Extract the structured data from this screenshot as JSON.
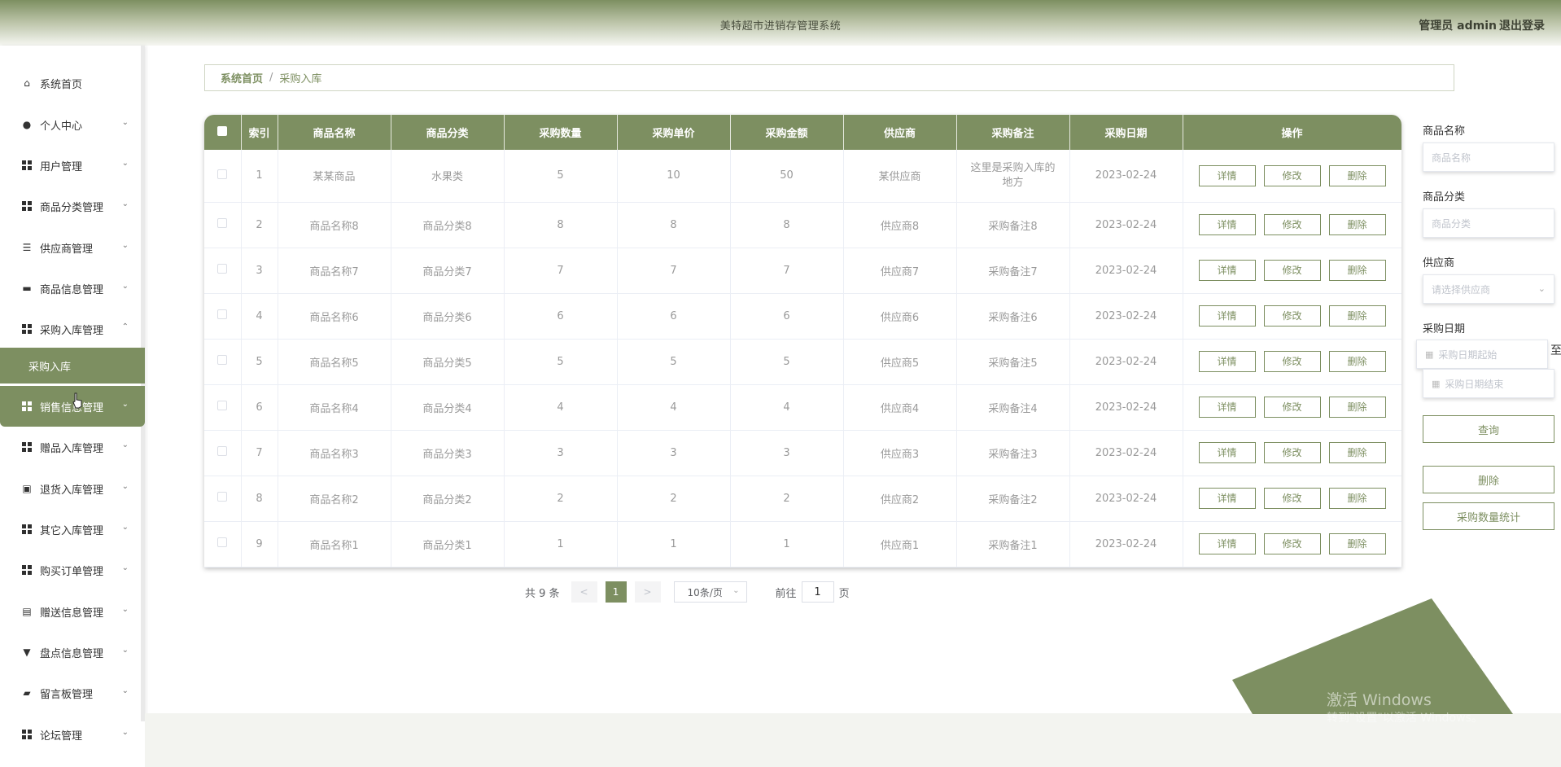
{
  "header": {
    "title": "美特超市进销存管理系统",
    "user_label": "管理员 admin",
    "logout_label": "退出登录"
  },
  "sidebar": {
    "items": [
      {
        "label": "系统首页",
        "icon": "home-icon",
        "chevron": ""
      },
      {
        "label": "个人中心",
        "icon": "user-icon",
        "chevron": "⌄"
      },
      {
        "label": "用户管理",
        "icon": "grid-icon",
        "chevron": "⌄"
      },
      {
        "label": "商品分类管理",
        "icon": "grid-icon",
        "chevron": "⌄"
      },
      {
        "label": "供应商管理",
        "icon": "list-icon",
        "chevron": "⌄"
      },
      {
        "label": "商品信息管理",
        "icon": "chat-icon",
        "chevron": "⌄"
      },
      {
        "label": "采购入库管理",
        "icon": "grid-icon",
        "chevron": "⌃"
      },
      {
        "label": "销售信息管理",
        "icon": "grid-icon",
        "chevron": "⌄"
      },
      {
        "label": "赠品入库管理",
        "icon": "grid9-icon",
        "chevron": "⌄"
      },
      {
        "label": "退货入库管理",
        "icon": "briefcase-icon",
        "chevron": "⌄"
      },
      {
        "label": "其它入库管理",
        "icon": "grid-icon",
        "chevron": "⌄"
      },
      {
        "label": "购买订单管理",
        "icon": "grid-icon",
        "chevron": "⌄"
      },
      {
        "label": "赠送信息管理",
        "icon": "clipboard-icon",
        "chevron": "⌄"
      },
      {
        "label": "盘点信息管理",
        "icon": "brush-icon",
        "chevron": "⌄"
      },
      {
        "label": "留言板管理",
        "icon": "printer-icon",
        "chevron": "⌄"
      },
      {
        "label": "论坛管理",
        "icon": "grid-icon",
        "chevron": "⌄"
      }
    ],
    "sub_item": "采购入库"
  },
  "breadcrumb": {
    "home": "系统首页",
    "separator": "/",
    "current": "采购入库"
  },
  "table": {
    "columns": [
      "索引",
      "商品名称",
      "商品分类",
      "采购数量",
      "采购单价",
      "采购金额",
      "供应商",
      "采购备注",
      "采购日期",
      "操作"
    ],
    "rows": [
      {
        "idx": "1",
        "name": "某某商品",
        "cat": "水果类",
        "qty": "5",
        "price": "10",
        "amount": "50",
        "supplier": "某供应商",
        "note": "这里是采购入库的地方",
        "date": "2023-02-24"
      },
      {
        "idx": "2",
        "name": "商品名称8",
        "cat": "商品分类8",
        "qty": "8",
        "price": "8",
        "amount": "8",
        "supplier": "供应商8",
        "note": "采购备注8",
        "date": "2023-02-24"
      },
      {
        "idx": "3",
        "name": "商品名称7",
        "cat": "商品分类7",
        "qty": "7",
        "price": "7",
        "amount": "7",
        "supplier": "供应商7",
        "note": "采购备注7",
        "date": "2023-02-24"
      },
      {
        "idx": "4",
        "name": "商品名称6",
        "cat": "商品分类6",
        "qty": "6",
        "price": "6",
        "amount": "6",
        "supplier": "供应商6",
        "note": "采购备注6",
        "date": "2023-02-24"
      },
      {
        "idx": "5",
        "name": "商品名称5",
        "cat": "商品分类5",
        "qty": "5",
        "price": "5",
        "amount": "5",
        "supplier": "供应商5",
        "note": "采购备注5",
        "date": "2023-02-24"
      },
      {
        "idx": "6",
        "name": "商品名称4",
        "cat": "商品分类4",
        "qty": "4",
        "price": "4",
        "amount": "4",
        "supplier": "供应商4",
        "note": "采购备注4",
        "date": "2023-02-24"
      },
      {
        "idx": "7",
        "name": "商品名称3",
        "cat": "商品分类3",
        "qty": "3",
        "price": "3",
        "amount": "3",
        "supplier": "供应商3",
        "note": "采购备注3",
        "date": "2023-02-24"
      },
      {
        "idx": "8",
        "name": "商品名称2",
        "cat": "商品分类2",
        "qty": "2",
        "price": "2",
        "amount": "2",
        "supplier": "供应商2",
        "note": "采购备注2",
        "date": "2023-02-24"
      },
      {
        "idx": "9",
        "name": "商品名称1",
        "cat": "商品分类1",
        "qty": "1",
        "price": "1",
        "amount": "1",
        "supplier": "供应商1",
        "note": "采购备注1",
        "date": "2023-02-24"
      }
    ],
    "actions": {
      "detail": "详情",
      "edit": "修改",
      "delete": "删除"
    }
  },
  "pagination": {
    "total": "共 9 条",
    "prev": "<",
    "current_page": "1",
    "next": ">",
    "page_size": "10条/页",
    "goto_prefix": "前往",
    "goto_value": "1",
    "goto_suffix": "页"
  },
  "filters": {
    "name_label": "商品名称",
    "name_placeholder": "商品名称",
    "category_label": "商品分类",
    "category_placeholder": "商品分类",
    "supplier_label": "供应商",
    "supplier_placeholder": "请选择供应商",
    "date_label": "采购日期",
    "date_start_placeholder": "采购日期起始",
    "date_end_placeholder": "采购日期结束",
    "to_label": "至",
    "search_button": "查询",
    "delete_button": "删除",
    "stats_button": "采购数量统计"
  },
  "watermark": {
    "line1": "激活 Windows",
    "line2": "转到\"设置\"以激活 Windows。"
  },
  "colors": {
    "accent": "#7d8f61",
    "header_top": "#7d8f61"
  }
}
